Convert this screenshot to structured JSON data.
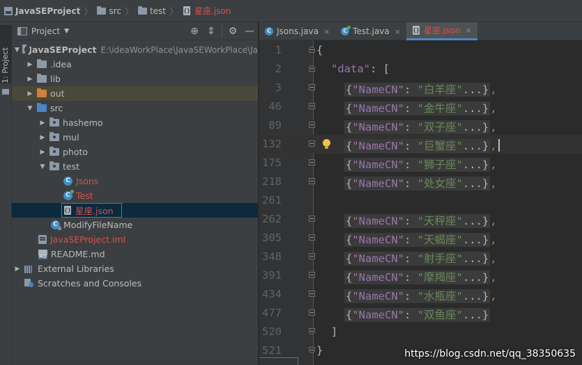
{
  "breadcrumb": [
    {
      "label": "JavaSEProject",
      "icon": "project-icon"
    },
    {
      "label": "src",
      "icon": "folder-icon"
    },
    {
      "label": "test",
      "icon": "folder-icon"
    },
    {
      "label": "星座.json",
      "icon": "json-file-icon"
    }
  ],
  "toolstrip": {
    "label": "1: Project"
  },
  "project_panel": {
    "title": "Project",
    "tools": [
      "globe-icon",
      "collapse-icon",
      "gear-icon",
      "minimize-icon"
    ]
  },
  "tree": {
    "root_label": "JavaSEProject",
    "root_path": "E:\\ideaWorkPlace\\JavaSEWorkPlace\\Ja",
    "idea": ".idea",
    "lib": "lib",
    "out": "out",
    "src": "src",
    "hashemo": "hashemo",
    "mul": "mul",
    "photo": "photo",
    "test": "test",
    "jsons": "Jsons",
    "test_class": "Test",
    "json_file": "星座.json",
    "modify": "ModifyFileName",
    "iml": "JavaSEProject.iml",
    "readme": "README.md",
    "ext_libs": "External Libraries",
    "scratches": "Scratches and Consoles"
  },
  "tabs": [
    {
      "label": "Jsons.java",
      "close": "×"
    },
    {
      "label": "Test.java",
      "close": "×"
    },
    {
      "label": "星座.json",
      "close": "×",
      "active": true
    }
  ],
  "editor": {
    "lines": [
      {
        "n": "1",
        "text": "{"
      },
      {
        "n": "2",
        "key": "\"data\"",
        "rest": ": ["
      },
      {
        "n": "3",
        "name": "白羊座"
      },
      {
        "n": "46",
        "name": "金牛座"
      },
      {
        "n": "89",
        "name": "双子座"
      },
      {
        "n": "132",
        "name": "巨蟹座"
      },
      {
        "n": "175",
        "name": "狮子座"
      },
      {
        "n": "218",
        "name": "处女座"
      },
      {
        "n": "261",
        "text": ""
      },
      {
        "n": "262",
        "name": "天秤座"
      },
      {
        "n": "305",
        "name": "天蝎座"
      },
      {
        "n": "348",
        "name": "射手座"
      },
      {
        "n": "391",
        "name": "摩羯座"
      },
      {
        "n": "434",
        "name": "水瓶座"
      },
      {
        "n": "477",
        "name": "双鱼座"
      },
      {
        "n": "520",
        "text": "]"
      },
      {
        "n": "521",
        "text": "}"
      }
    ],
    "folded_key": "\"NameCN\"",
    "folded_open": "{",
    "folded_close": "...}",
    "comma": ","
  },
  "watermark": "https://blog.csdn.net/qq_38350635",
  "colors": {
    "background": "#2b2b2b",
    "panel": "#3c3f41",
    "selection": "#0d293e",
    "json_file_text": "#d3544a",
    "string": "#6a8759",
    "key": "#9876aa"
  }
}
